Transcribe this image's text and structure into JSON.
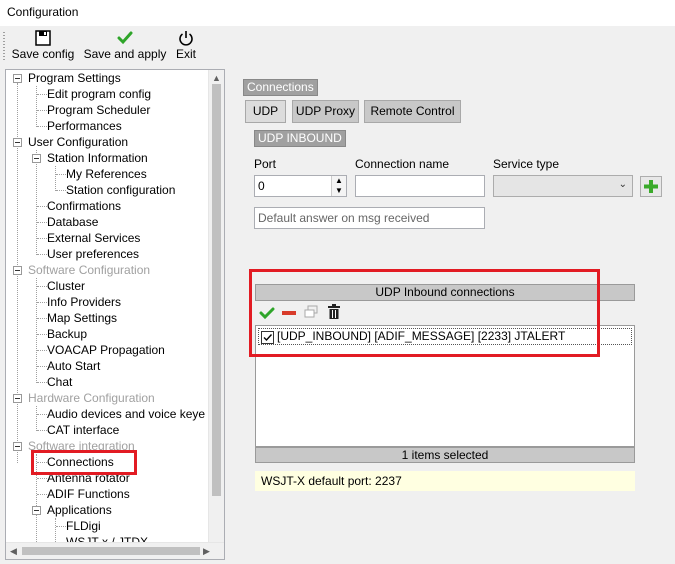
{
  "window": {
    "title": "Configuration"
  },
  "toolbar": {
    "save_config": "Save config",
    "save_and_apply": "Save and apply",
    "exit": "Exit"
  },
  "tree": {
    "items": [
      "Program Settings",
      "Edit program config",
      "Program Scheduler",
      "Performances",
      "User Configuration",
      "Station Information",
      "My References",
      "Station configuration",
      "Confirmations",
      "Database",
      "External Services",
      "User preferences",
      "Software Configuration",
      "Cluster",
      "Info Providers",
      "Map Settings",
      "Backup",
      "VOACAP Propagation",
      "Auto Start",
      "Chat",
      "Hardware Configuration",
      "Audio devices and voice keye",
      "CAT interface",
      "Software integration",
      "Connections",
      "Antenna rotator",
      "ADIF Functions",
      "Applications",
      "FLDigi",
      "WSJT-x / JTDX"
    ],
    "selected": "Connections"
  },
  "panel": {
    "section_label": "Connections",
    "tabs": [
      "UDP",
      "UDP Proxy",
      "Remote Control"
    ],
    "active_tab": "UDP",
    "sub_label": "UDP INBOUND",
    "port_label": "Port",
    "port_value": "0",
    "connection_name_label": "Connection name",
    "connection_name_value": "",
    "service_type_label": "Service type",
    "service_type_value": "",
    "default_answer_placeholder": "Default answer on msg received"
  },
  "grid": {
    "title": "UDP Inbound connections",
    "rows": [
      {
        "checked": true,
        "text": "[UDP_INBOUND] [ADIF_MESSAGE] [2233] JTALERT"
      }
    ],
    "footer": "1 items selected"
  },
  "info": {
    "text": "WSJT-X default port: 2237"
  },
  "colors": {
    "highlight": "#e21b23",
    "info_bg": "#ffffe1",
    "label_bg": "#a0a0a0"
  }
}
